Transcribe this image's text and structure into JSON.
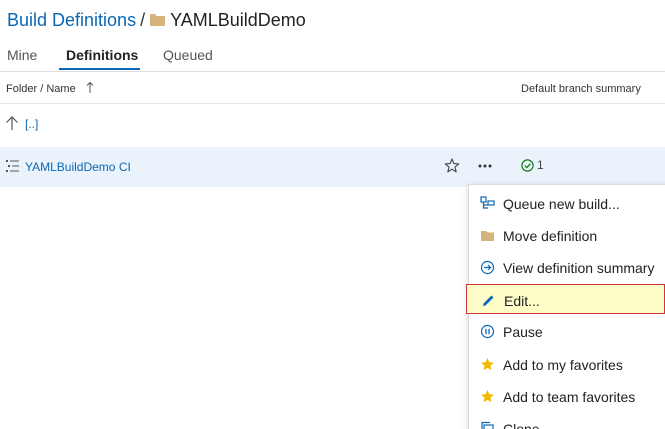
{
  "breadcrumb": {
    "root": "Build Definitions",
    "separator": "/",
    "current": "YAMLBuildDemo"
  },
  "tabs": [
    {
      "label": "Mine"
    },
    {
      "label": "Definitions"
    },
    {
      "label": "Queued"
    }
  ],
  "table": {
    "col_name": "Folder / Name",
    "col_summary": "Default branch summary",
    "up_link": "[..]",
    "rows": [
      {
        "name": "YAMLBuildDemo CI",
        "status_count": "1"
      }
    ]
  },
  "context_menu": {
    "items": [
      {
        "label": "Queue new build...",
        "icon": "queue-build-icon"
      },
      {
        "label": "Move definition",
        "icon": "folder-icon"
      },
      {
        "label": "View definition summary",
        "icon": "arrow-circle-icon"
      },
      {
        "label": "Edit...",
        "icon": "pencil-icon"
      },
      {
        "label": "Pause",
        "icon": "pause-icon"
      },
      {
        "label": "Add to my favorites",
        "icon": "star-icon"
      },
      {
        "label": "Add to team favorites",
        "icon": "star-icon"
      },
      {
        "label": "Clone",
        "icon": "clone-icon"
      }
    ]
  },
  "colors": {
    "link": "#0a67b5",
    "selected_row": "#eaf3fb",
    "highlight_fill": "#fefdc7",
    "highlight_border": "#d1343b",
    "success": "#107c10",
    "favorite": "#f2b700",
    "folder": "#d6b37a"
  }
}
